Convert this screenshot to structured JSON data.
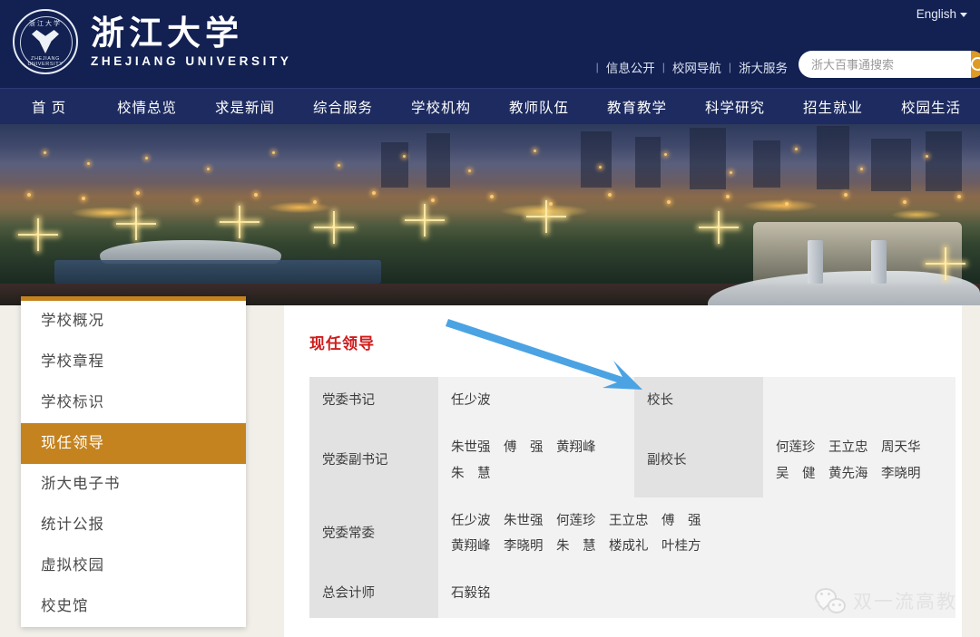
{
  "header": {
    "logo": {
      "seal_top_text": "浙江大学",
      "seal_bottom_text": "ZHEJIANG UNIVERSITY",
      "wordmark_cn": "浙江大学",
      "wordmark_en": "ZHEJIANG UNIVERSITY"
    },
    "language": "English",
    "quick_links": [
      "信息公开",
      "校网导航",
      "浙大服务"
    ],
    "search": {
      "placeholder": "浙大百事通搜索",
      "value": "",
      "button_icon": "search-icon",
      "button_color": "#dd9a28"
    },
    "bg_color": "#122052"
  },
  "nav": {
    "bg_color": "#1d2b60",
    "items": [
      {
        "label": "首 页"
      },
      {
        "label": "校情总览"
      },
      {
        "label": "求是新闻"
      },
      {
        "label": "综合服务"
      },
      {
        "label": "学校机构"
      },
      {
        "label": "教师队伍"
      },
      {
        "label": "教育教学"
      },
      {
        "label": "科学研究"
      },
      {
        "label": "招生就业"
      },
      {
        "label": "校园生活"
      }
    ]
  },
  "banner": {
    "description": "浙江大学校园夜景全景图",
    "alt": "campus-night-panorama"
  },
  "sidebar": {
    "accent_color": "#c4831f",
    "items": [
      {
        "label": "学校概况",
        "active": false
      },
      {
        "label": "学校章程",
        "active": false
      },
      {
        "label": "学校标识",
        "active": false
      },
      {
        "label": "现任领导",
        "active": true
      },
      {
        "label": "浙大电子书",
        "active": false
      },
      {
        "label": "统计公报",
        "active": false
      },
      {
        "label": "虚拟校园",
        "active": false
      },
      {
        "label": "校史馆",
        "active": false
      }
    ]
  },
  "content": {
    "title": "现任领导",
    "title_color": "#d01b1b",
    "table": {
      "rows": [
        {
          "left_label": "党委书记",
          "left_value": "任少波",
          "right_label": "校长",
          "right_value": ""
        },
        {
          "left_label": "党委副书记",
          "left_value_line1": "朱世强　傅　强　黄翔峰",
          "left_value_line2": "朱　慧",
          "right_label": "副校长",
          "right_value_line1": "何莲珍　王立忠　周天华",
          "right_value_line2": "吴　健　黄先海　李晓明"
        },
        {
          "left_label": "党委常委",
          "left_value_line1": "任少波　朱世强　何莲珍　王立忠　傅　强",
          "left_value_line2": "黄翔峰　李晓明　朱　慧　楼成礼　叶桂方"
        },
        {
          "left_label": "总会计师",
          "left_value": "石毅铭"
        }
      ]
    }
  },
  "annotation": {
    "arrow_color": "#4ba3e3",
    "points_to": "校长"
  },
  "watermark": {
    "icon": "wechat-icon",
    "text": "双一流高教",
    "color": "#d6d6d6"
  }
}
